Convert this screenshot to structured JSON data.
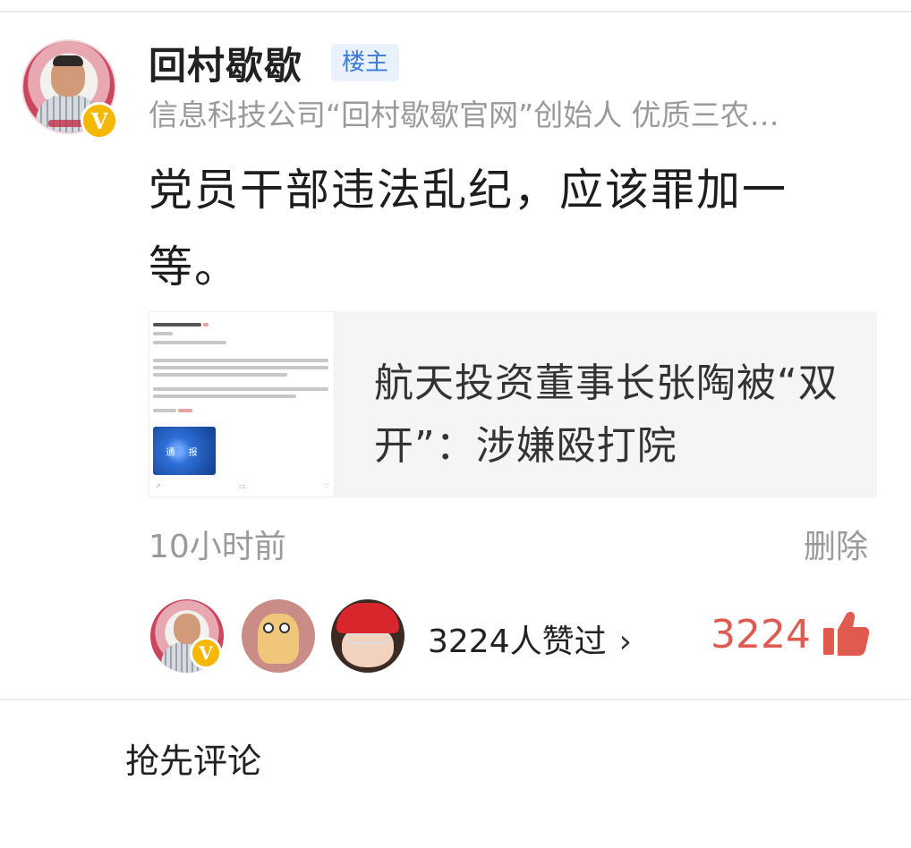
{
  "post": {
    "author": "回村歇歇",
    "op_badge": "楼主",
    "bio": "信息科技公司“回村歇歇官网”创始人 优质三农…",
    "content": "党员干部违法乱纪，应该罪加一等。",
    "timestamp": "10小时前",
    "delete_label": "删除"
  },
  "shared_card": {
    "title": "航天投资董事长张陶被“双开”：涉嫌殴打院",
    "thumbnail_banner_text": "通 报"
  },
  "likes": {
    "summary": "3224人赞过",
    "chevron": "›",
    "count": "3224"
  },
  "comment": {
    "prompt": "抢先评论"
  },
  "icons": {
    "verified": "verified-v-icon",
    "like": "thumbs-up-icon",
    "chevron": "chevron-right-icon"
  },
  "colors": {
    "like_red": "#e05a4f",
    "badge_blue": "#3a7bd5",
    "verified_gold": "#f5b800"
  }
}
